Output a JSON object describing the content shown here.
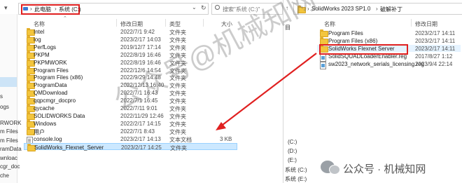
{
  "left_window": {
    "breadcrumb": [
      "此电脑",
      "系统 (C:)"
    ],
    "search_placeholder": "搜索\"系统 (C:)\"",
    "headers": {
      "name": "名称",
      "date": "修改日期",
      "type": "类型",
      "size": "大小"
    },
    "nav_items": [
      "s",
      "ogs",
      "RWORK",
      "m Files",
      "m Files",
      "ramData",
      "wnloac",
      "cgr_doc",
      "che"
    ],
    "rows": [
      {
        "name": "Intel",
        "date": "2022/7/1 9:42",
        "type": "文件夹",
        "size": "",
        "icon": "folder-icon"
      },
      {
        "name": "log",
        "date": "2023/2/17 14:03",
        "type": "文件夹",
        "size": "",
        "icon": "folder-icon"
      },
      {
        "name": "PerfLogs",
        "date": "2019/12/7 17:14",
        "type": "文件夹",
        "size": "",
        "icon": "folder-icon"
      },
      {
        "name": "PKPM",
        "date": "2022/8/19 16:46",
        "type": "文件夹",
        "size": "",
        "icon": "folder-icon"
      },
      {
        "name": "PKPMWORK",
        "date": "2022/8/19 16:46",
        "type": "文件夹",
        "size": "",
        "icon": "folder-icon"
      },
      {
        "name": "Program Files",
        "date": "2022/12/6 14:54",
        "type": "文件夹",
        "size": "",
        "icon": "folder-icon"
      },
      {
        "name": "Program Files (x86)",
        "date": "2022/9/29 14:48",
        "type": "文件夹",
        "size": "",
        "icon": "folder-icon"
      },
      {
        "name": "ProgramData",
        "date": "2022/12/13 16:40",
        "type": "文件夹",
        "size": "",
        "icon": "folder-icon"
      },
      {
        "name": "QMDownload",
        "date": "2022/7/1 16:43",
        "type": "文件夹",
        "size": "",
        "icon": "folder-icon"
      },
      {
        "name": "qqpcmgr_docpro",
        "date": "2022/7/1 16:45",
        "type": "文件夹",
        "size": "",
        "icon": "folder-icon"
      },
      {
        "name": "qycache",
        "date": "2022/7/11 9:01",
        "type": "文件夹",
        "size": "",
        "icon": "folder-icon"
      },
      {
        "name": "SOLIDWORKS Data",
        "date": "2022/11/29 12:46",
        "type": "文件夹",
        "size": "",
        "icon": "folder-icon"
      },
      {
        "name": "Windows",
        "date": "2022/2/17 14:15",
        "type": "文件夹",
        "size": "",
        "icon": "folder-icon"
      },
      {
        "name": "用户",
        "date": "2022/7/1 8:43",
        "type": "文件夹",
        "size": "",
        "icon": "folder-icon"
      },
      {
        "name": "console.log",
        "date": "2023/2/17 14:13",
        "type": "文本文档",
        "size": "3 KB",
        "icon": "log-file-icon"
      },
      {
        "name": "SolidWorks_Flexnet_Server",
        "date": "2023/2/17 14:25",
        "type": "文件夹",
        "size": "",
        "icon": "folder-icon",
        "selected": true
      }
    ]
  },
  "right_window": {
    "breadcrumb": [
      "SolidWorks 2023 SP1.0",
      "破解补丁"
    ],
    "headers": {
      "name": "名称",
      "date": "修改日期"
    },
    "rows": [
      {
        "name": "Program Files",
        "date": "2023/2/17 14:11",
        "icon": "folder-icon"
      },
      {
        "name": "Program Files (x86)",
        "date": "2023/2/17 14:11",
        "icon": "folder-icon"
      },
      {
        "name": "SolidWorks Flexnet Server",
        "date": "2023/2/17 14:11",
        "icon": "folder-icon",
        "highlighted": true
      },
      {
        "name": "SolidSQUADLoaderEnabler.reg",
        "date": "2017/8/27 1:12",
        "icon": "reg-file-icon"
      },
      {
        "name": "sw2023_network_serials_licensing.reg",
        "date": "2023/9/4 22:14",
        "icon": "reg-file-icon"
      }
    ],
    "nav_items": [
      "(C:)",
      "(D:)",
      "(E:)",
      "系统 (C:)",
      "系统 (E:)"
    ],
    "cut_nav_top": "目"
  },
  "watermark": {
    "big_text": "公众号@机械知网",
    "badge_text": "公众号 · 机械知网"
  },
  "colors": {
    "highlight_red": "#e02020",
    "selected_row": "#cce8ff",
    "folder": "#f3c53d"
  }
}
